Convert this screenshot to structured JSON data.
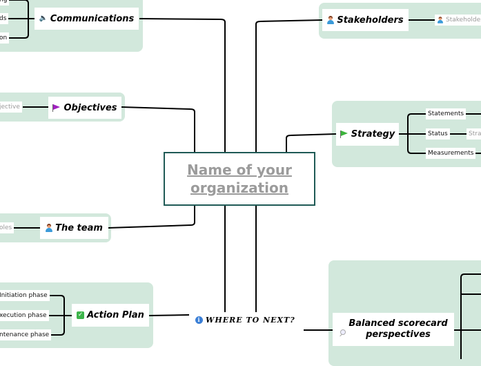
{
  "central_topic": {
    "title_line1": "Name of your",
    "title_line2": "organization"
  },
  "floating_topic": {
    "label": "WHERE TO NEXT?",
    "icon": "info-icon"
  },
  "colors": {
    "group_bg": "#d2e8dc",
    "central_border": "#1f5a55",
    "central_text": "#9b9b9b",
    "line": "#000000",
    "muted_text": "#9a9a9a"
  },
  "branches": {
    "communications": {
      "label": "Communications",
      "icon": "speaker-icon",
      "children": [
        "ng",
        "ds",
        "on"
      ]
    },
    "objectives": {
      "label": "Objectives",
      "icon": "purple-flag-icon",
      "children": [
        "jective"
      ]
    },
    "the_team": {
      "label": "The team",
      "icon": "person-icon",
      "children": [
        "oles"
      ]
    },
    "action_plan": {
      "label": "Action Plan",
      "icon": "check-icon",
      "children": [
        "Initiation phase",
        "xecution phase",
        "ntenance phase"
      ]
    },
    "stakeholders": {
      "label": "Stakeholders",
      "icon": "person-icon",
      "children": [
        "Stakeholder"
      ]
    },
    "strategy": {
      "label": "Strategy",
      "icon": "green-flag-icon",
      "children": [
        "Statements",
        "Status",
        "Measurements"
      ],
      "status_child": "Stra"
    },
    "balanced_scorecard": {
      "label_line1": "Balanced scorecard",
      "label_line2": "perspectives",
      "icon": "search-icon"
    }
  }
}
